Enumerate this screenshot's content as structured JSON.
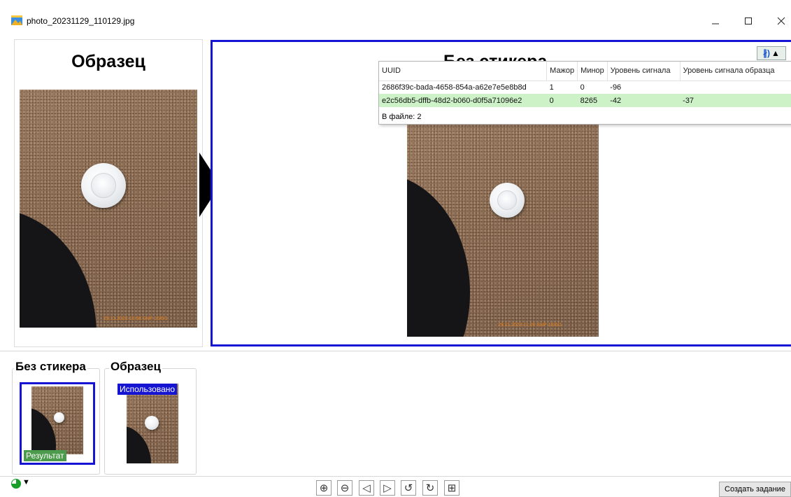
{
  "window": {
    "title": "photo_20231129_110129.jpg",
    "minimize_icon": "minimize-icon",
    "maximize_icon": "maximize-icon",
    "close_icon": "close-icon"
  },
  "sample_panel": {
    "title": "Образец",
    "photo_stamp": "29.11.2023 10:58 SNP 15/6/1"
  },
  "main_panel": {
    "title": "Без стикера",
    "photo_stamp": "29.11.2023 11:00 SNP 15/6/1"
  },
  "bluetooth_toggle": {
    "icon": "bluetooth-icon",
    "glyph": "∦)",
    "state_glyph": "▲"
  },
  "beacon_table": {
    "columns": [
      "UUID",
      "Мажор",
      "Минор",
      "Уровень сигнала",
      "Уровень сигнала образца"
    ],
    "rows": [
      {
        "uuid": "2686f39c-bada-4658-854a-a62e7e5e8b8d",
        "major": "1",
        "minor": "0",
        "signal": "-96",
        "sample_signal": "",
        "highlight": false
      },
      {
        "uuid": "e2c56db5-dffb-48d2-b060-d0f5a71096e2",
        "major": "0",
        "minor": "8265",
        "signal": "-42",
        "sample_signal": "-37",
        "highlight": true
      }
    ],
    "footer": "В файле: 2",
    "highlight_color": "#cdf2c8"
  },
  "groups": {
    "no_sticker": {
      "label": "Без стикера",
      "badge": "Результат"
    },
    "sample": {
      "label": "Образец",
      "badge": "Использовано"
    }
  },
  "toolbar": {
    "status_caret": "▼",
    "zoom_in": "⊕",
    "zoom_out": "⊖",
    "prev": "◁",
    "next": "▷",
    "rotate_left": "↺",
    "rotate_right": "↻",
    "grid": "⊞",
    "create_task": "Создать задание"
  },
  "colors": {
    "accent_blue": "#1414d2",
    "result_green": "#4c9a4c",
    "status_green": "#1a9e2a"
  }
}
